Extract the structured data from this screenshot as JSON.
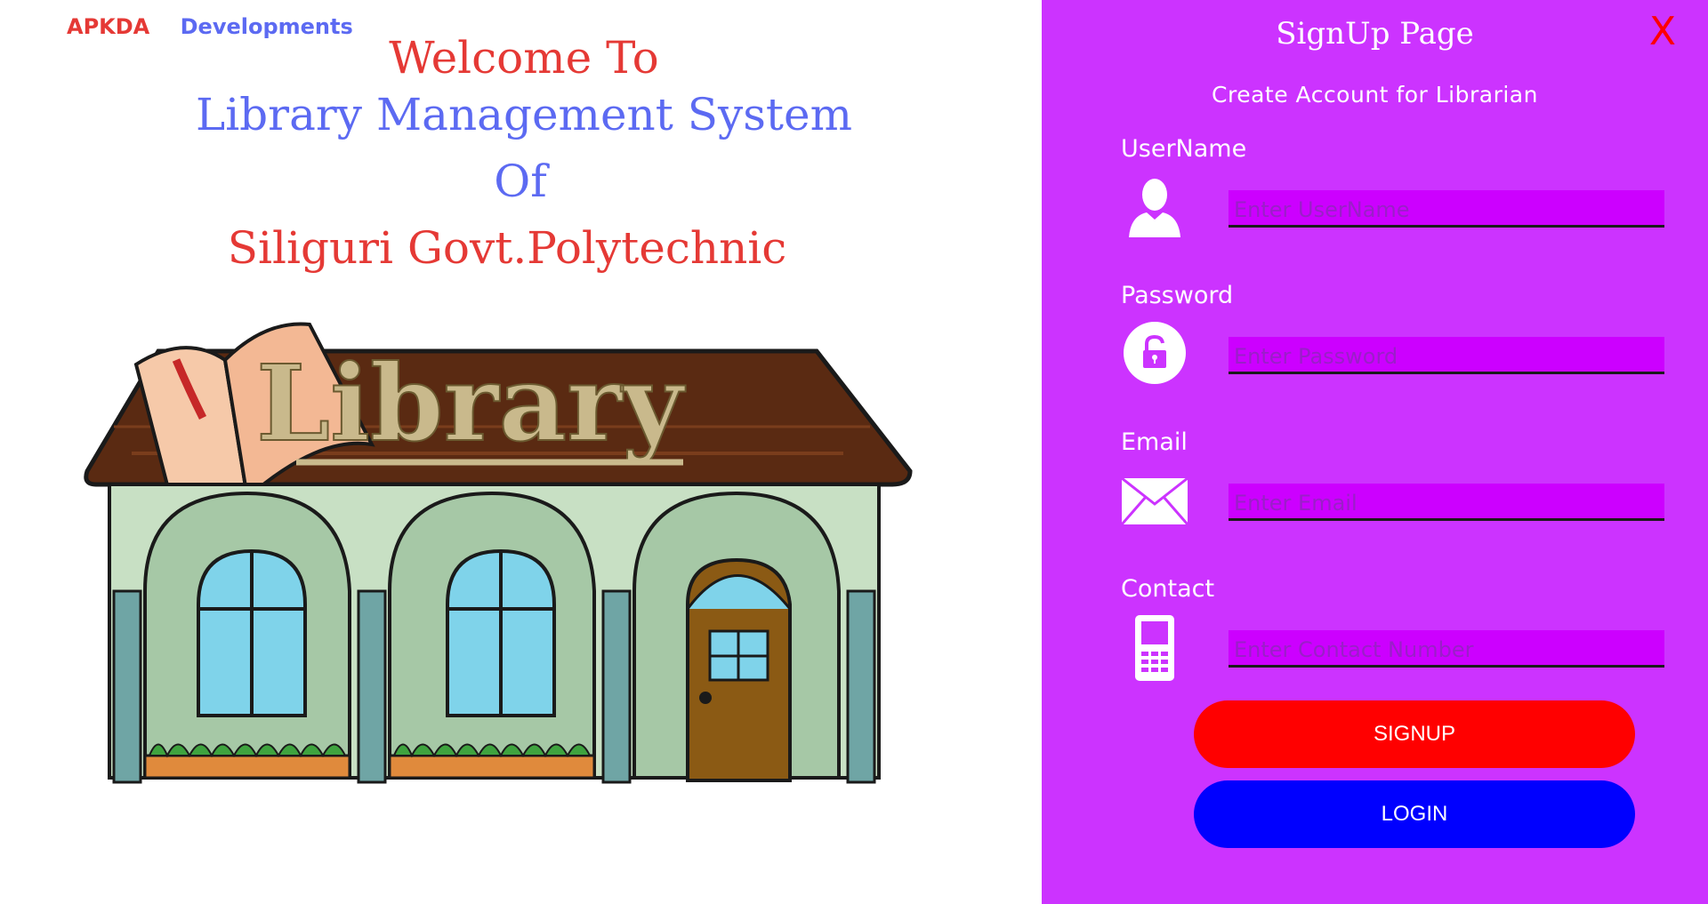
{
  "brand": {
    "part1": "APKDA",
    "part2": "Developments"
  },
  "welcome": {
    "line1": "Welcome To",
    "line2": "Library Management System",
    "line3": "Of",
    "line4": "Siliguri Govt.Polytechnic"
  },
  "illustration": {
    "sign_text": "Library"
  },
  "signup": {
    "title": "SignUp Page",
    "close_label": "X",
    "subtitle": "Create Account for Librarian",
    "fields": [
      {
        "label": "UserName",
        "placeholder": "Enter UserName",
        "icon": "user-icon"
      },
      {
        "label": "Password",
        "placeholder": "Enter Password",
        "icon": "lock-icon"
      },
      {
        "label": "Email",
        "placeholder": "Enter Email",
        "icon": "envelope-icon"
      },
      {
        "label": "Contact",
        "placeholder": "Enter Contact Number",
        "icon": "phone-icon"
      }
    ],
    "signup_button": "SIGNUP",
    "login_button": "LOGIN"
  },
  "colors": {
    "panel_bg": "#cc33ff",
    "input_bg": "#cc00ff",
    "signup_button": "#ff0000",
    "login_button": "#0000ff",
    "accent_red": "#e53935",
    "accent_blue": "#5c6af2"
  }
}
